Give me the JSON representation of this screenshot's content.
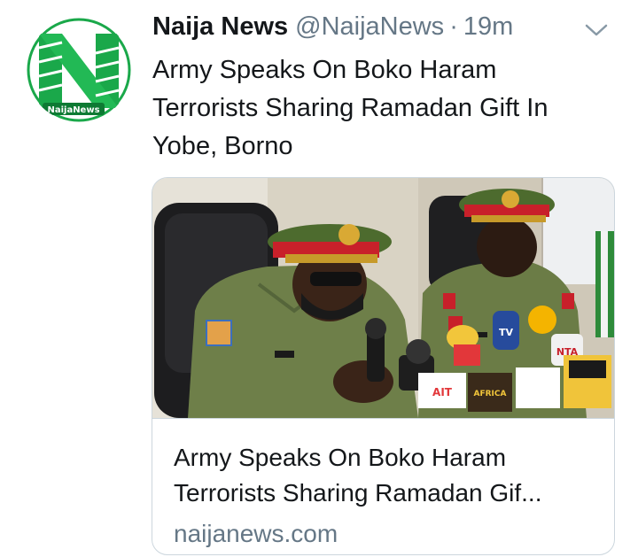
{
  "tweet": {
    "display_name": "Naija News",
    "handle": "@NaijaNews",
    "separator": "·",
    "timestamp": "19m",
    "text_lines": [
      "Army Speaks On Boko Haram",
      "Terrorists Sharing Ramadan Gift In",
      "Yobe, Borno"
    ]
  },
  "avatar": {
    "icon": "naija-news-logo",
    "logo_text": "NaijaNews",
    "colors": {
      "green": "#1aa84a",
      "dark_green": "#0e7a33",
      "white": "#ffffff"
    }
  },
  "menu": {
    "icon": "chevron-down-icon"
  },
  "card": {
    "title_lines": [
      "Army Speaks On Boko Haram",
      "Terrorists Sharing Ramadan Gif..."
    ],
    "domain": "naijanews.com",
    "image_icon": "press-conference-photo",
    "mic_labels": [
      "TV",
      "NTA",
      "AIT",
      "AFRICA"
    ]
  },
  "colors": {
    "text_primary": "#14171a",
    "text_secondary": "#657786",
    "border": "#ccd6dd"
  }
}
